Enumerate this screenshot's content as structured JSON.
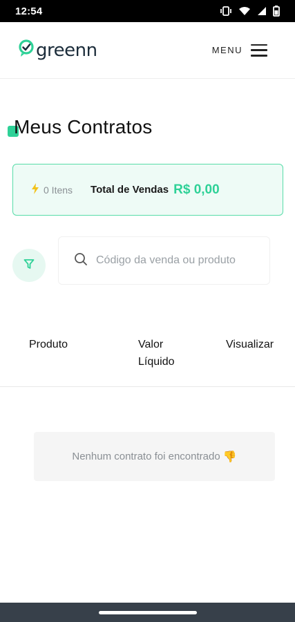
{
  "status_bar": {
    "time": "12:54",
    "icons": [
      "vibrate-icon",
      "wifi-icon",
      "signal-icon",
      "battery-icon"
    ]
  },
  "header": {
    "logo_text": "greenn",
    "menu_label": "MENU"
  },
  "page": {
    "title": "Meus Contratos"
  },
  "summary": {
    "items_count": "0 Itens",
    "total_label": "Total de Vendas",
    "total_value": "R$ 0,00"
  },
  "search": {
    "placeholder": "Código da venda ou produto"
  },
  "table": {
    "columns": [
      "Produto",
      "Valor Líquido",
      "Visualizar"
    ]
  },
  "empty_state": {
    "message": "Nenhum contrato foi encontrado",
    "emoji": "👎"
  },
  "colors": {
    "accent": "#2ed197",
    "card_background": "#eefbf6",
    "card_border": "#57dca8",
    "nav_bar": "#37404a"
  }
}
